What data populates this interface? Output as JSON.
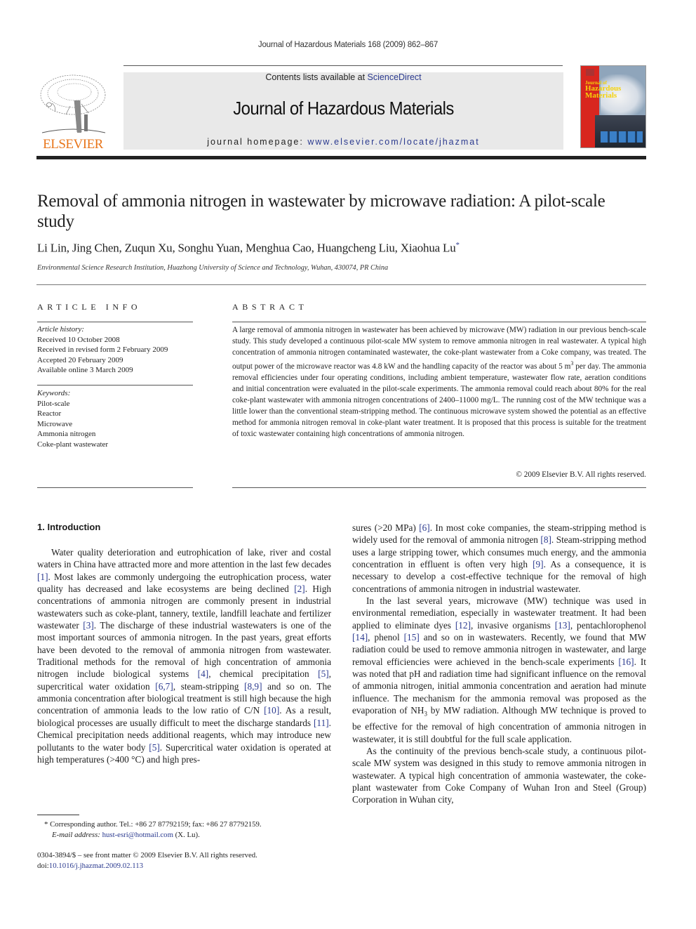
{
  "running_header": "Journal of Hazardous Materials 168 (2009) 862–867",
  "masthead": {
    "publisher_logo_text": "ELSEVIER",
    "contents_prefix": "Contents lists available at ",
    "contents_link": "ScienceDirect",
    "journal_title": "Journal of Hazardous Materials",
    "homepage_prefix": "journal homepage: ",
    "homepage_link": "www.elsevier.com/locate/jhazmat",
    "cover": {
      "line1": "Journal of",
      "line2": "Hazardous",
      "line3": "Materials"
    },
    "colors": {
      "elsevier_orange": "#e8751a",
      "link_blue": "#2b3a8f",
      "banner_gray": "#e9e9e9",
      "cover_red": "#d8261f"
    }
  },
  "article": {
    "title": "Removal of ammonia nitrogen in wastewater by microwave radiation: A pilot-scale study",
    "authors": "Li Lin, Jing Chen, Zuqun Xu, Songhu Yuan, Menghua Cao, Huangcheng Liu, Xiaohua Lu",
    "corresponding_mark": "*",
    "affiliation": "Environmental Science Research Institution, Huazhong University of Science and Technology, Wuhan, 430074, PR China"
  },
  "article_info": {
    "heading": "ARTICLE INFO",
    "history_label": "Article history:",
    "history": [
      "Received 10 October 2008",
      "Received in revised form 2 February 2009",
      "Accepted 20 February 2009",
      "Available online 3 March 2009"
    ],
    "keywords_label": "Keywords:",
    "keywords": [
      "Pilot-scale",
      "Reactor",
      "Microwave",
      "Ammonia nitrogen",
      "Coke-plant wastewater"
    ]
  },
  "abstract": {
    "heading": "ABSTRACT",
    "text_a": "A large removal of ammonia nitrogen in wastewater has been achieved by microwave (MW) radiation in our previous bench-scale study. This study developed a continuous pilot-scale MW system to remove ammonia nitrogen in real wastewater. A typical high concentration of ammonia nitrogen contaminated wastewater, the coke-plant wastewater from a Coke company, was treated. The output power of the microwave reactor was 4.8 kW and the handling capacity of the reactor was about 5 m",
    "text_sup": "3",
    "text_b": " per day. The ammonia removal efficiencies under four operating conditions, including ambient temperature, wastewater flow rate, aeration conditions and initial concentration were evaluated in the pilot-scale experiments. The ammonia removal could reach about 80% for the real coke-plant wastewater with ammonia nitrogen concentrations of 2400–11000 mg/L. The running cost of the MW technique was a little lower than the conventional steam-stripping method. The continuous microwave system showed the potential as an effective method for ammonia nitrogen removal in coke-plant water treatment. It is proposed that this process is suitable for the treatment of toxic wastewater containing high concentrations of ammonia nitrogen.",
    "copyright": "© 2009 Elsevier B.V. All rights reserved."
  },
  "section1": {
    "heading": "1.  Introduction",
    "left_col": [
      {
        "t": "Water quality deterioration and eutrophication of lake, river and costal waters in China have attracted more and more attention in the last few decades "
      },
      {
        "ref": "[1]"
      },
      {
        "t": ". Most lakes are commonly undergoing the eutrophication process, water quality has decreased and lake ecosystems are being declined "
      },
      {
        "ref": "[2]"
      },
      {
        "t": ". High concentrations of ammonia nitrogen are commonly present in industrial wastewaters such as coke-plant, tannery, textile, landfill leachate and fertilizer wastewater "
      },
      {
        "ref": "[3]"
      },
      {
        "t": ". The discharge of these industrial wastewaters is one of the most important sources of ammonia nitrogen. In the past years, great efforts have been devoted to the removal of ammonia nitrogen from wastewater. Traditional methods for the removal of high concentration of ammonia nitrogen include biological systems "
      },
      {
        "ref": "[4]"
      },
      {
        "t": ", chemical precipitation "
      },
      {
        "ref": "[5]"
      },
      {
        "t": ", supercritical water oxidation "
      },
      {
        "ref": "[6,7]"
      },
      {
        "t": ", steam-stripping "
      },
      {
        "ref": "[8,9]"
      },
      {
        "t": " and so on. The ammonia concentration after biological treatment is still high because the high concentration of ammonia leads to the low ratio of C/N "
      },
      {
        "ref": "[10]"
      },
      {
        "t": ". As a result, biological processes are usually difficult to meet the discharge standards "
      },
      {
        "ref": "[11]"
      },
      {
        "t": ". Chemical precipitation needs additional reagents, which may introduce new pollutants to the water body "
      },
      {
        "ref": "[5]"
      },
      {
        "t": ". Supercritical water oxidation is operated at high temperatures (>400 °C) and high pres-"
      }
    ],
    "right_p1": [
      {
        "t": "sures (>20 MPa) "
      },
      {
        "ref": "[6]"
      },
      {
        "t": ". In most coke companies, the steam-stripping method is widely used for the removal of ammonia nitrogen "
      },
      {
        "ref": "[8]"
      },
      {
        "t": ". Steam-stripping method uses a large stripping tower, which consumes much energy, and the ammonia concentration in effluent is often very high "
      },
      {
        "ref": "[9]"
      },
      {
        "t": ". As a consequence, it is necessary to develop a cost-effective technique for the removal of high concentrations of ammonia nitrogen in industrial wastewater."
      }
    ],
    "right_p2": [
      {
        "t": "In the last several years, microwave (MW) technique was used in environmental remediation, especially in wastewater treatment. It had been applied to eliminate dyes "
      },
      {
        "ref": "[12]"
      },
      {
        "t": ", invasive organisms "
      },
      {
        "ref": "[13]"
      },
      {
        "t": ", pentachlorophenol "
      },
      {
        "ref": "[14]"
      },
      {
        "t": ", phenol "
      },
      {
        "ref": "[15]"
      },
      {
        "t": " and so on in wastewaters. Recently, we found that MW radiation could be used to remove ammonia nitrogen in wastewater, and large removal efficiencies were achieved in the bench-scale experiments "
      },
      {
        "ref": "[16]"
      },
      {
        "t": ". It was noted that pH and radiation time had significant influence on the removal of ammonia nitrogen, initial ammonia concentration and aeration had minute influence. The mechanism for the ammonia removal was proposed as the evaporation of NH"
      },
      {
        "sub": "3"
      },
      {
        "t": " by MW radiation. Although MW technique is proved to be effective for the removal of high concentration of ammonia nitrogen in wastewater, it is still doubtful for the full scale application."
      }
    ],
    "right_p3": [
      {
        "t": "As the continuity of the previous bench-scale study, a continuous pilot-scale MW system was designed in this study to remove ammonia nitrogen in wastewater. A typical high concentration of ammonia wastewater, the coke-plant wastewater from Coke Company of Wuhan Iron and Steel (Group) Corporation in Wuhan city,"
      }
    ]
  },
  "footnotes": {
    "corresponding": "*   Corresponding author. Tel.: +86 27 87792159; fax: +86 27 87792159.",
    "email_label": "E-mail address: ",
    "email": "hust-esri@hotmail.com",
    "email_suffix": " (X. Lu).",
    "issn_line": "0304-3894/$ – see front matter © 2009 Elsevier B.V. All rights reserved.",
    "doi_prefix": "doi:",
    "doi": "10.1016/j.jhazmat.2009.02.113"
  }
}
